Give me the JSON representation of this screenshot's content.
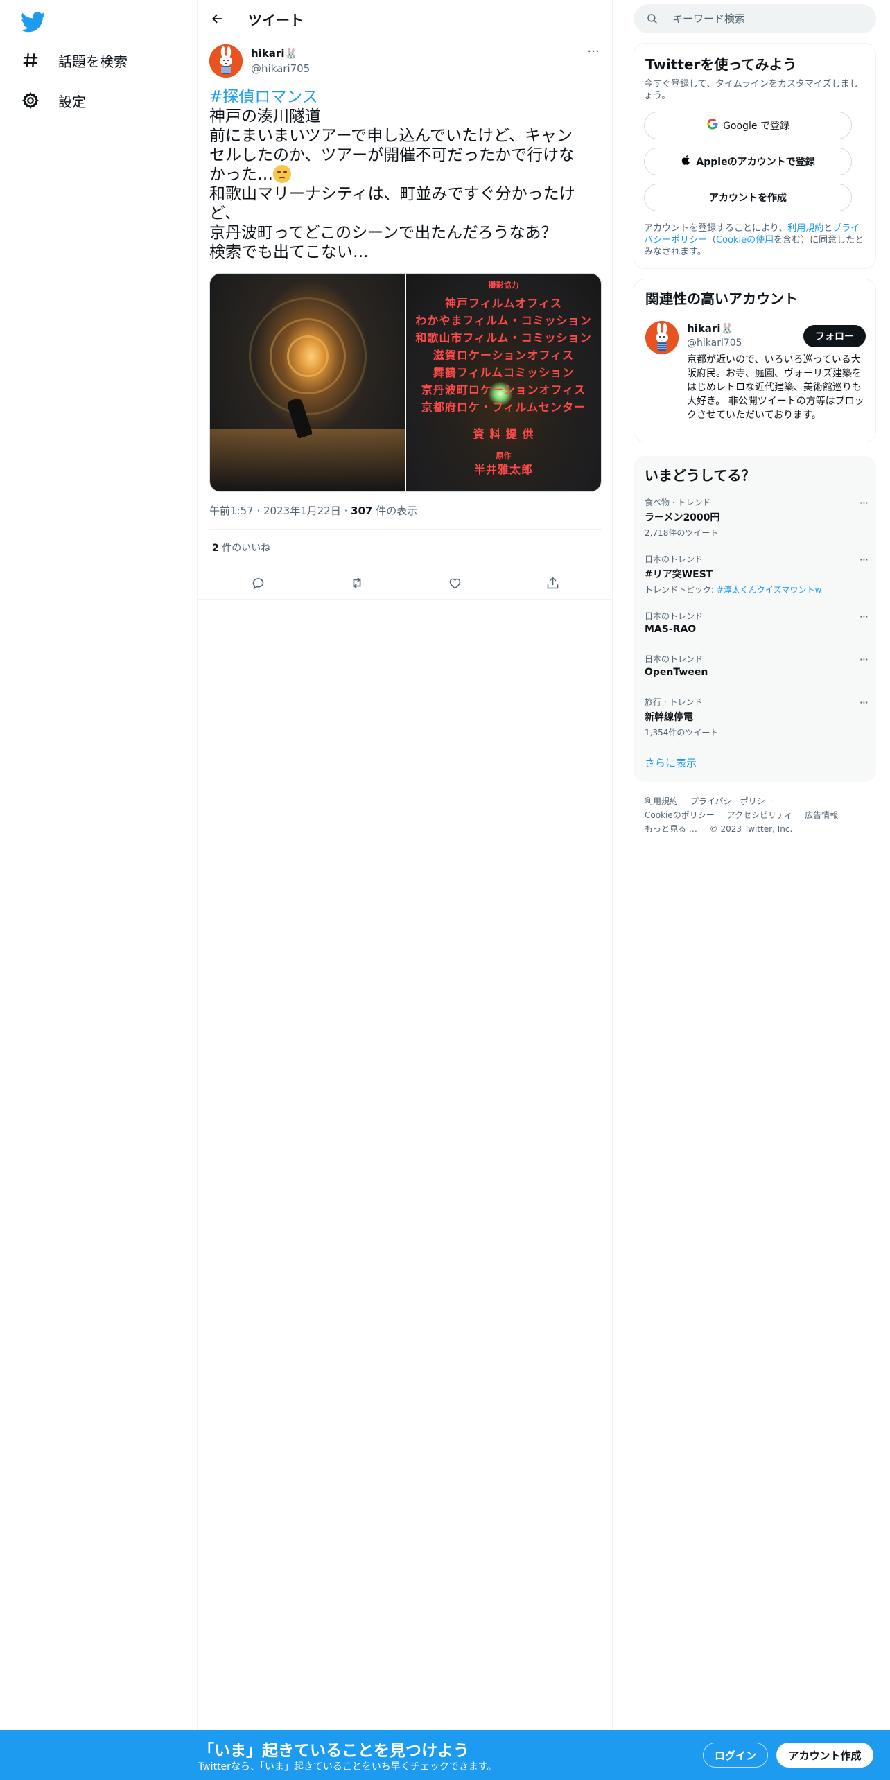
{
  "nav": {
    "explore_label": "話題を検索",
    "settings_label": "設定"
  },
  "main": {
    "title": "ツイート"
  },
  "tweet": {
    "user_name": "hikari🐰",
    "user_handle": "@hikari705",
    "hashtag": "#探偵ロマンス",
    "lines": [
      "神戸の湊川隧道",
      "前にまいまいツアーで申し込んでいたけど、キャン",
      "セルしたのか、ツアーが開催不可だったかで行けな",
      "かった…",
      "和歌山マリーナシティは、町並みですぐ分かったけ",
      "ど、",
      "京丹波町ってどこのシーンで出たんだろうなあ？",
      "検索でも出てこない…"
    ],
    "time": "午前1:57",
    "date": "2023年1月22日",
    "views_count": "307",
    "views_label": "件の表示",
    "likes_count": "2",
    "likes_label": "件のいいね",
    "image2_credits": {
      "heading": "撮影協力",
      "lines": [
        "神戸フィルムオフィス",
        "わかやまフィルム・コミッション",
        "和歌山市フィルム・コミッション",
        "滋賀ロケーションオフィス",
        "舞鶴フィルムコミッション",
        "京丹波町ロケーションオフィス",
        "京都府ロケ・フィルムセンター"
      ],
      "section": "資 料 提 供",
      "footer_label": "原作",
      "footer_name": "半井雅太郎"
    }
  },
  "search": {
    "placeholder": "キーワード検索"
  },
  "signup": {
    "title": "Twitterを使ってみよう",
    "subtitle": "今すぐ登録して、タイムラインをカスタマイズしましょう。",
    "google_label": "Google で登録",
    "apple_label": "Appleのアカウントで登録",
    "create_label": "アカウントを作成",
    "legal_prefix": "アカウントを登録することにより、",
    "legal_terms": "利用規約",
    "legal_and": "と",
    "legal_privacy": "プライバシーポリシー",
    "legal_paren_open": "（",
    "legal_cookie": "Cookieの使用",
    "legal_suffix": "を含む）に同意したとみなされます。"
  },
  "related": {
    "title": "関連性の高いアカウント",
    "name": "hikari🐰",
    "handle": "@hikari705",
    "follow_label": "フォロー",
    "bio": "京都が近いので、いろいろ巡っている大阪府民。お寺、庭園、ヴォーリズ建築をはじめレトロな近代建築、美術館巡りも大好き。 非公開ツイートの方等はブロックさせていただいております。"
  },
  "trends": {
    "title": "いまどうしてる？",
    "items": [
      {
        "category": "食べ物 · トレンド",
        "name": "ラーメン2000円",
        "count": "2,718件のツイート"
      },
      {
        "category": "日本のトレンド",
        "name": "#リア突WEST",
        "count": "トレンドトピック: ",
        "topic": "#淳太くんクイズマウントw"
      },
      {
        "category": "日本のトレンド",
        "name": "MAS-RAO",
        "count": ""
      },
      {
        "category": "日本のトレンド",
        "name": "OpenTween",
        "count": ""
      },
      {
        "category": "旅行 · トレンド",
        "name": "新幹線停電",
        "count": "1,354件のツイート"
      }
    ],
    "show_more": "さらに表示"
  },
  "footer": {
    "links": [
      "利用規約",
      "プライバシーポリシー",
      "Cookieのポリシー",
      "アクセシビリティ",
      "広告情報",
      "もっと見る …"
    ],
    "copyright": "© 2023 Twitter, Inc."
  },
  "bottombar": {
    "title": "「いま」起きていることを見つけよう",
    "subtitle": "Twitterなら、「いま」起きていることをいち早くチェックできます。",
    "login_label": "ログイン",
    "signup_label": "アカウント作成"
  },
  "colors": {
    "accent": "#1d9bf0",
    "text": "#0f1419",
    "muted": "#536471",
    "avatar": "#e8531f"
  }
}
